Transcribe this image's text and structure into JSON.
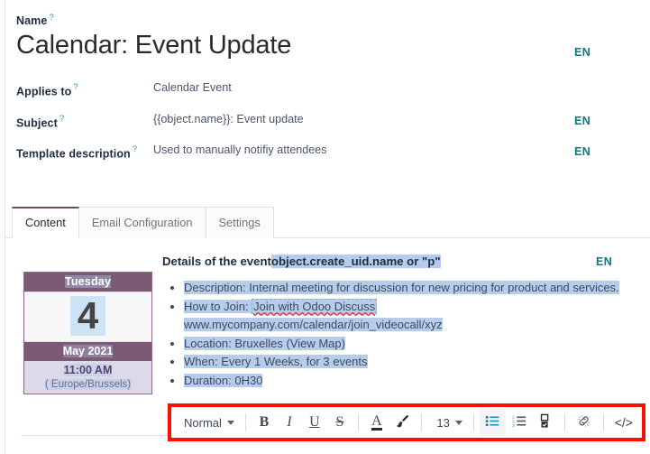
{
  "form": {
    "name_label": "Name",
    "title": "Calendar: Event Update",
    "title_lang": "EN",
    "fields": [
      {
        "label": "Applies to",
        "value": "Calendar Event",
        "lang": ""
      },
      {
        "label": "Subject",
        "value": "{{object.name}}: Event update",
        "lang": "EN"
      },
      {
        "label": "Template description",
        "value": "Used to manually notifiy attendees",
        "lang": "EN"
      }
    ],
    "help_mark": "?"
  },
  "tabs": [
    {
      "label": "Content",
      "active": true
    },
    {
      "label": "Email Configuration",
      "active": false
    },
    {
      "label": "Settings",
      "active": false
    }
  ],
  "calendar_card": {
    "day_of_week": "Tuesday",
    "day_number": "4",
    "month_year": "May 2021",
    "time": "11:00 AM",
    "timezone": "( Europe/Brussels)"
  },
  "content": {
    "heading_plain": "Details of the event",
    "heading_placeholder": "object.create_uid.name or \"p\"",
    "lang": "EN",
    "bullets": [
      {
        "prefix": "Description: ",
        "text": "Internal meeting for discussion for new pricing for product and services."
      },
      {
        "prefix": "How to Join: ",
        "link_text": "Join with Odoo Discuss",
        "misspelled": "Odoo",
        "url": "www.mycompany.com/calendar/join_videocall/xyz"
      },
      {
        "prefix": "Location: ",
        "text": "Bruxelles (View Map)"
      },
      {
        "prefix": "When: ",
        "text": "Every 1 Weeks, for 3 events"
      },
      {
        "prefix": "Duration: ",
        "text": "0H30"
      }
    ]
  },
  "toolbar": {
    "style_select": "Normal",
    "bold": "B",
    "italic": "I",
    "underline": "U",
    "strikethrough": "S",
    "font_color": "A",
    "background_color": "brush-icon",
    "font_size": "13",
    "unordered_list": "bulleted-list-icon",
    "ordered_list": "numbered-list-icon",
    "checklist": "checklist-icon",
    "unlink": "unlink-icon",
    "code": "</>"
  },
  "colors": {
    "accent_purple": "#714b67",
    "calendar_header": "#7c5975",
    "lang_badge": "#017e84",
    "selection": "#b5ccec",
    "annotation": "#fa0f00",
    "active_tool": "#2196bf"
  }
}
